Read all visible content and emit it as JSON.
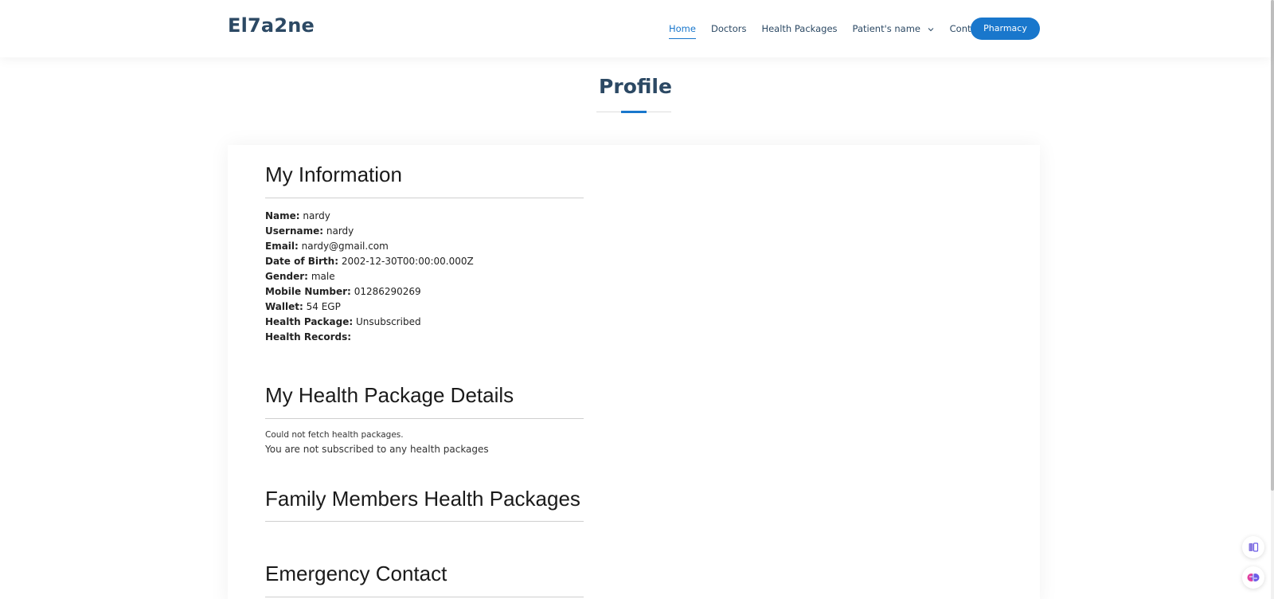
{
  "header": {
    "logo": "El7a2ne",
    "nav": [
      {
        "label": "Home",
        "active": true
      },
      {
        "label": "Doctors"
      },
      {
        "label": "Health Packages"
      },
      {
        "label": "Patient's name",
        "dropdown": true
      },
      {
        "label": "Contact"
      }
    ],
    "pharmacy_label": "Pharmacy"
  },
  "page": {
    "title": "Profile"
  },
  "my_information": {
    "title": "My Information",
    "fields": [
      {
        "label": "Name:",
        "value": "nardy"
      },
      {
        "label": "Username:",
        "value": "nardy"
      },
      {
        "label": "Email:",
        "value": "nardy@gmail.com"
      },
      {
        "label": "Date of Birth:",
        "value": "2002-12-30T00:00:00.000Z"
      },
      {
        "label": "Gender:",
        "value": "male"
      },
      {
        "label": "Mobile Number:",
        "value": "01286290269"
      },
      {
        "label": "Wallet:",
        "value": "54 EGP"
      },
      {
        "label": "Health Package:",
        "value": "Unsubscribed"
      },
      {
        "label": "Health Records:",
        "value": ""
      }
    ]
  },
  "health_package_details": {
    "title": "My Health Package Details",
    "error": "Could not fetch health packages.",
    "message": "You are not subscribed to any health packages"
  },
  "family_packages": {
    "title": "Family Members Health Packages"
  },
  "emergency_contact": {
    "title": "Emergency Contact"
  },
  "colors": {
    "brand": "#2c4964",
    "accent": "#1977cc"
  },
  "icons": {
    "float_top": "book-icon",
    "float_bottom": "brain-icon"
  }
}
